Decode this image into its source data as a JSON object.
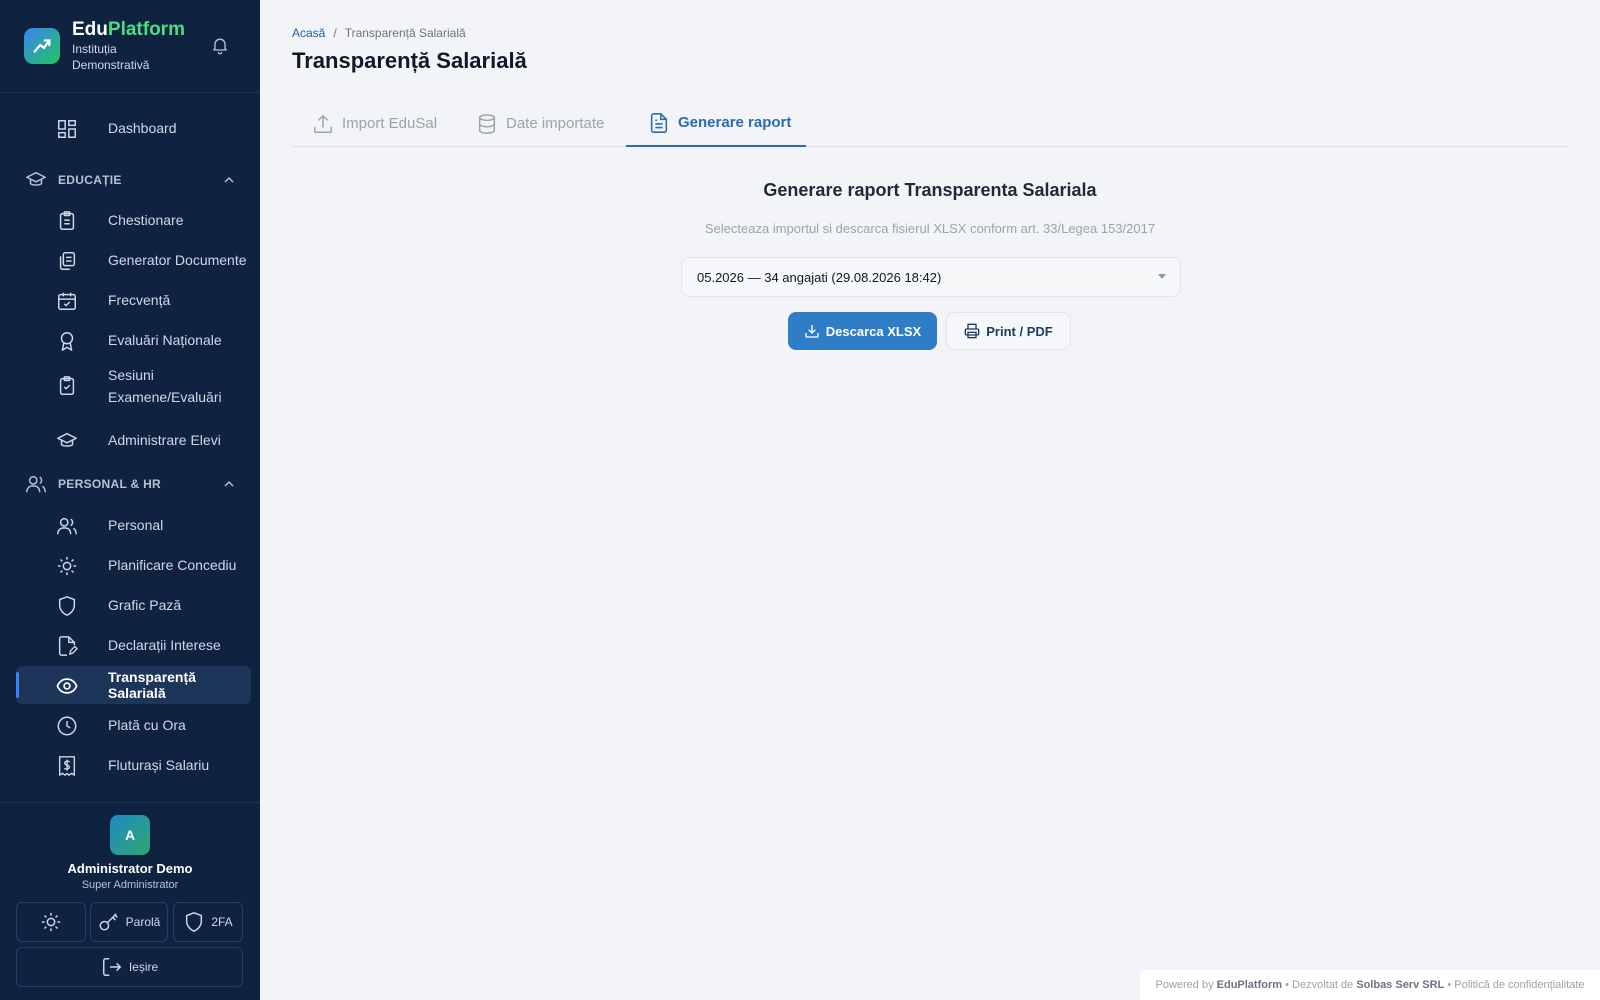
{
  "brand": {
    "name_part1": "Edu",
    "name_part2": "Platform",
    "institution": "Instituția Demonstrativă"
  },
  "sidebar": {
    "dashboard": "Dashboard",
    "sections": [
      {
        "label": "EDUCAȚIE",
        "items": [
          "Chestionare",
          "Generator Documente",
          "Frecvență",
          "Evaluări Naționale",
          "Sesiuni Examene/Evaluări",
          "Administrare Elevi"
        ]
      },
      {
        "label": "PERSONAL & HR",
        "items": [
          "Personal",
          "Planificare Concediu",
          "Grafic Pază",
          "Declarații Interese",
          "Transparență Salarială",
          "Plată cu Ora",
          "Fluturași Salariu"
        ]
      }
    ],
    "active_item": "Transparență Salarială"
  },
  "user": {
    "initial": "A",
    "name": "Administrator Demo",
    "role": "Super Administrator",
    "password_label": "Parolă",
    "twofa_label": "2FA",
    "logout_label": "Ieșire"
  },
  "breadcrumb": {
    "home": "Acasă",
    "separator": "/",
    "current": "Transparență Salarială"
  },
  "page": {
    "title": "Transparență Salarială"
  },
  "tabs": [
    {
      "label": "Import EduSal",
      "icon": "upload-icon"
    },
    {
      "label": "Date importate",
      "icon": "database-icon"
    },
    {
      "label": "Generare raport",
      "icon": "document-icon",
      "active": true
    }
  ],
  "report": {
    "title": "Generare raport Transparenta Salariala",
    "subtitle": "Selecteaza importul si descarca fisierul XLSX conform art. 33/Legea 153/2017",
    "selected_import": "05.2026 — 34 angajati (29.08.2026 18:42)",
    "download_label": "Descarca XLSX",
    "print_label": "Print / PDF"
  },
  "footer": {
    "powered_prefix": "Powered by",
    "powered_brand": "EduPlatform",
    "dev_prefix": "• Dezvoltat de",
    "dev_company": "Solbas Serv SRL",
    "privacy": "• Politică de confidențialitate"
  },
  "colors": {
    "sidebar_bg": "#0f2340",
    "accent": "#2f7cc7",
    "brand_green": "#4ade80"
  }
}
